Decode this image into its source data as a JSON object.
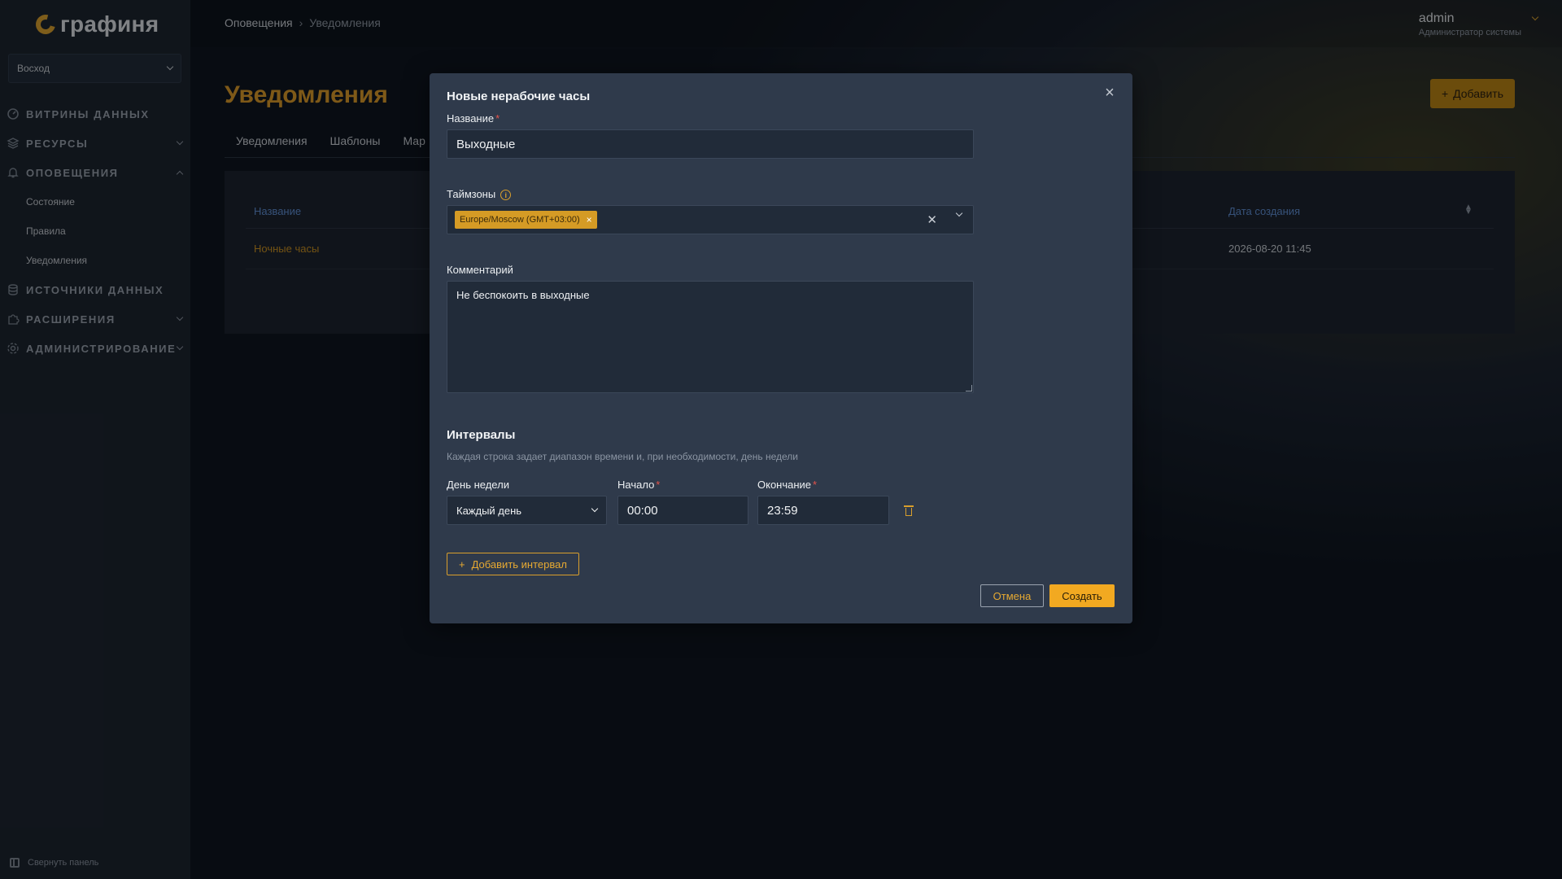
{
  "app": {
    "logo_text": "графиня"
  },
  "sidebar": {
    "org_select": "Восход",
    "items": [
      {
        "label": "ВИТРИНЫ ДАННЫХ",
        "icon": "dashboard-icon"
      },
      {
        "label": "РЕСУРСЫ",
        "icon": "layers-icon"
      },
      {
        "label": "ОПОВЕЩЕНИЯ",
        "icon": "bell-icon"
      },
      {
        "label": "ИСТОЧНИКИ ДАННЫХ",
        "icon": "database-icon"
      },
      {
        "label": "РАСШИРЕНИЯ",
        "icon": "puzzle-icon"
      },
      {
        "label": "АДМИНИСТРИРОВАНИЕ",
        "icon": "gear-icon"
      }
    ],
    "alerts_sub": [
      "Состояние",
      "Правила",
      "Уведомления"
    ],
    "collapse_label": "Свернуть панель"
  },
  "header": {
    "breadcrumb": [
      "Оповещения",
      "Уведомления"
    ],
    "user_name": "admin",
    "user_role": "Администратор системы"
  },
  "page": {
    "title": "Уведомления",
    "add_label": "Добавить",
    "tabs": [
      "Уведомления",
      "Шаблоны",
      "Мар"
    ],
    "table": {
      "col_name": "Название",
      "col_created": "Дата создания",
      "rows": [
        {
          "name": "Ночные часы",
          "created": "2026-08-20 11:45"
        }
      ]
    }
  },
  "modal": {
    "title": "Новые нерабочие часы",
    "name_label": "Название",
    "name_value": "Выходные",
    "tz_label": "Таймзоны",
    "tz_tag": "Europe/Moscow (GMT+03:00)",
    "comment_label": "Комментарий",
    "comment_value": "Не беспокоить в выходные",
    "intervals_title": "Интервалы",
    "intervals_hint": "Каждая строка задает диапазон времени и, при необходимости, день недели",
    "day_label": "День недели",
    "day_value": "Каждый день",
    "start_label": "Начало",
    "start_value": "00:00",
    "end_label": "Окончание",
    "end_value": "23:59",
    "add_interval_label": "Добавить интервал",
    "cancel_label": "Отмена",
    "create_label": "Создать"
  },
  "colors": {
    "accent": "#f2a921",
    "link": "#5f8ed2",
    "modal_bg": "#2f3a4b"
  }
}
